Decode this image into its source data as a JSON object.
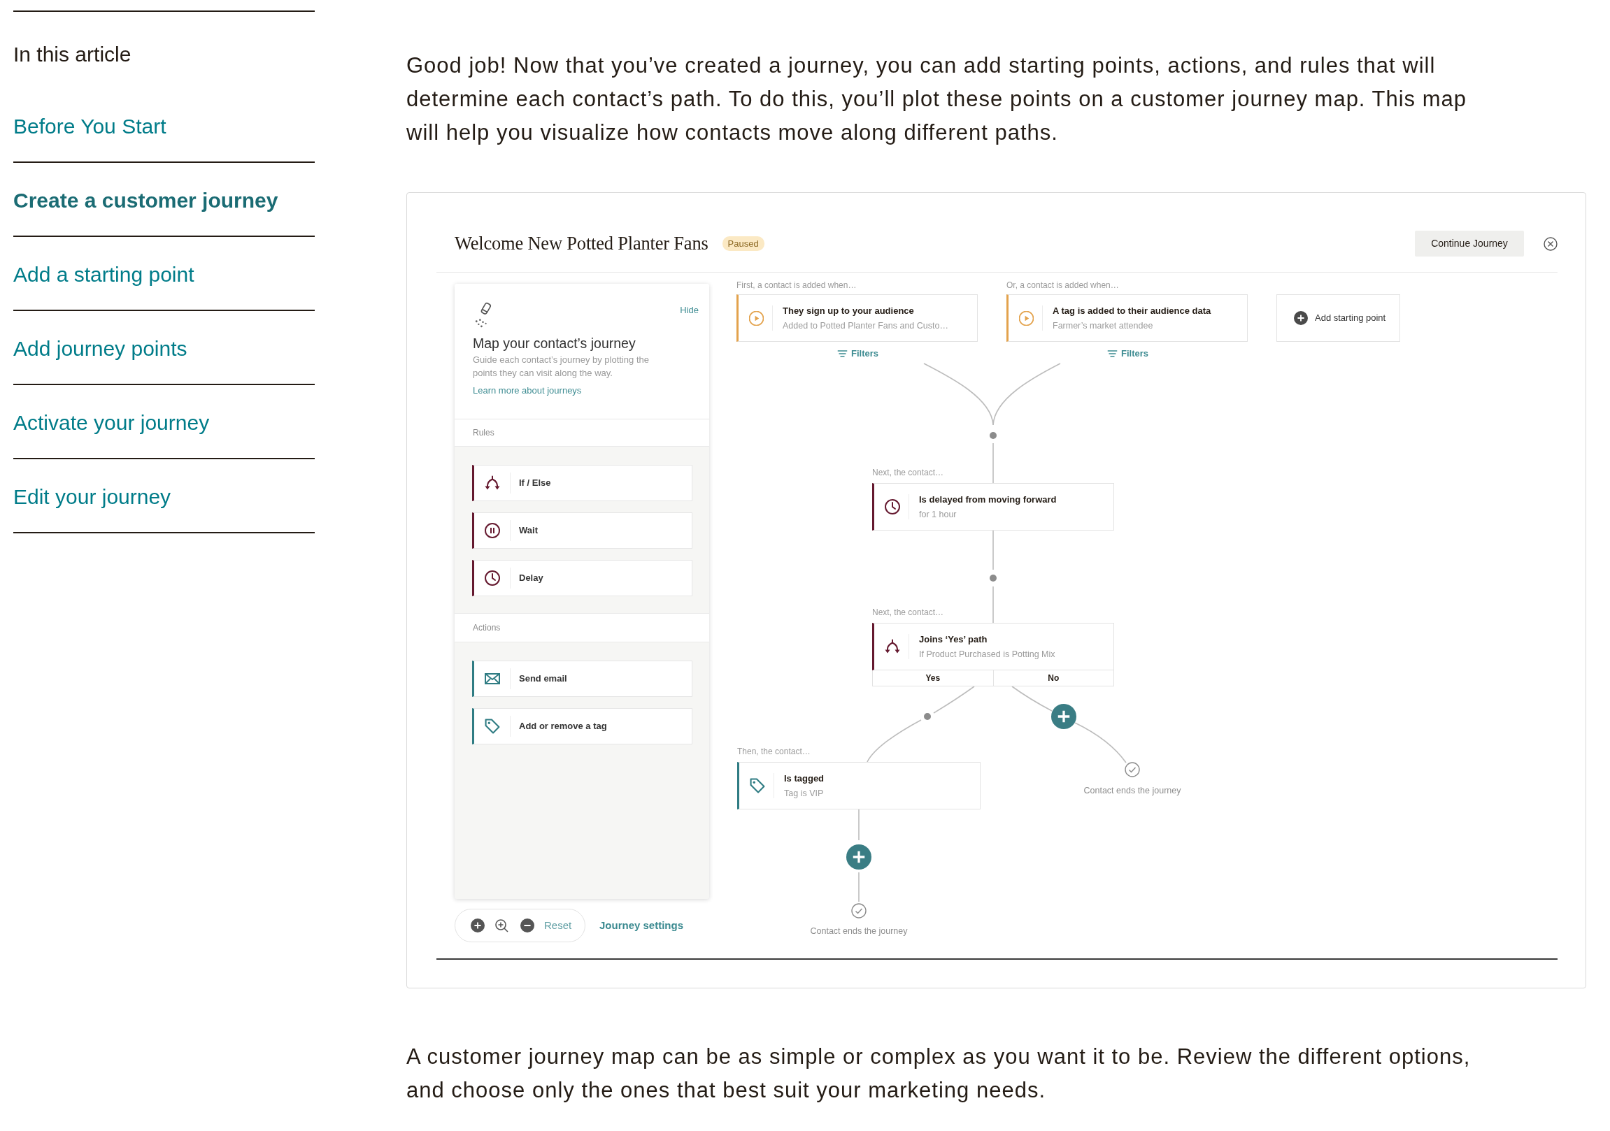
{
  "sidebar": {
    "heading": "In this article",
    "items": [
      {
        "label": "Before You Start",
        "selected": false
      },
      {
        "label": "Create a customer journey",
        "selected": true
      },
      {
        "label": "Add a starting point",
        "selected": false
      },
      {
        "label": "Add journey points",
        "selected": false
      },
      {
        "label": "Activate your journey",
        "selected": false
      },
      {
        "label": "Edit your journey",
        "selected": false
      }
    ]
  },
  "article": {
    "intro": "Good job! Now that you’ve created a journey, you can add starting points, actions, and rules that will determine each contact’s path. To do this, you’ll plot these points on a customer journey map. This map will help you visualize how contacts move along different paths.",
    "figure": {
      "title": "Welcome New Potted Planter Fans",
      "status": "Paused",
      "continue_button": "Continue Journey",
      "panel": {
        "hide_link": "Hide",
        "heading": "Map your contact’s journey",
        "description": "Guide each contact’s journey by plotting the points they can visit along the way.",
        "learn_more_link": "Learn more about journeys",
        "sections": [
          {
            "title": "Rules",
            "items": [
              {
                "label": "If / Else",
                "kind": "if-else"
              },
              {
                "label": "Wait",
                "kind": "wait"
              },
              {
                "label": "Delay",
                "kind": "delay"
              }
            ]
          },
          {
            "title": "Actions",
            "items": [
              {
                "label": "Send email",
                "kind": "email"
              },
              {
                "label": "Add or remove a tag",
                "kind": "tag"
              }
            ]
          }
        ]
      },
      "zoom_controls": {
        "reset": "Reset"
      },
      "settings_link": "Journey settings",
      "starting_points": [
        {
          "caption": "First, a contact is added when…",
          "title": "They sign up to your audience",
          "detail": "Added to Potted Planter Fans and Custo…",
          "filters": "Filters"
        },
        {
          "caption": "Or, a contact is added when…",
          "title": "A tag is added to their audience data",
          "detail": "Farmer’s market attendee",
          "filters": "Filters"
        }
      ],
      "add_starting_point": "Add starting point",
      "steps": [
        {
          "kind": "delay",
          "caption": "Next, the contact…",
          "title": "Is delayed from moving forward",
          "detail": "for 1 hour"
        },
        {
          "kind": "if-else",
          "caption": "Next, the contact…",
          "title": "Joins ‘Yes’ path",
          "detail": "If Product Purchased is Potting Mix",
          "branches": [
            "Yes",
            "No"
          ]
        },
        {
          "kind": "tag",
          "caption": "Then, the contact…",
          "title": "Is tagged",
          "detail": "Tag is VIP"
        }
      ],
      "endings": [
        "Contact ends the journey",
        "Contact ends the journey"
      ]
    },
    "outro": "A customer journey map can be as simple or complex as you want it to be. Review the different options, and choose only the ones that best suit your marketing needs."
  }
}
